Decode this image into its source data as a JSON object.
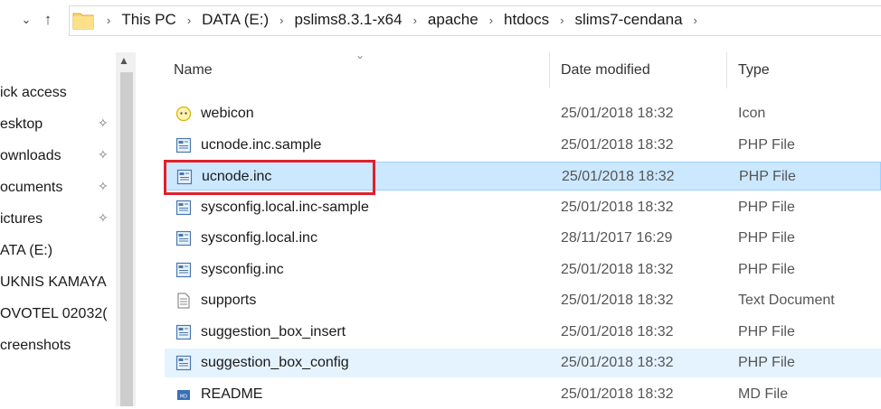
{
  "breadcrumb": [
    "This PC",
    "DATA (E:)",
    "pslims8.3.1-x64",
    "apache",
    "htdocs",
    "slims7-cendana"
  ],
  "nav": [
    {
      "label": "ick access",
      "pinned": false
    },
    {
      "label": "esktop",
      "pinned": true
    },
    {
      "label": "ownloads",
      "pinned": true
    },
    {
      "label": "ocuments",
      "pinned": true
    },
    {
      "label": "ictures",
      "pinned": true
    },
    {
      "label": "ATA (E:)",
      "pinned": false
    },
    {
      "label": "UKNIS KAMAYA",
      "pinned": false
    },
    {
      "label": "OVOTEL 02032(",
      "pinned": false
    },
    {
      "label": "creenshots",
      "pinned": false
    }
  ],
  "columns": {
    "name": "Name",
    "date": "Date modified",
    "type": "Type"
  },
  "files": [
    {
      "name": "webicon",
      "date": "25/01/2018 18:32",
      "type": "Icon",
      "icon": "favicon-icon"
    },
    {
      "name": "ucnode.inc.sample",
      "date": "25/01/2018 18:32",
      "type": "PHP File",
      "icon": "php-file-icon"
    },
    {
      "name": "ucnode.inc",
      "date": "25/01/2018 18:32",
      "type": "PHP File",
      "icon": "php-file-icon",
      "selected": true
    },
    {
      "name": "sysconfig.local.inc-sample",
      "date": "25/01/2018 18:32",
      "type": "PHP File",
      "icon": "php-file-icon"
    },
    {
      "name": "sysconfig.local.inc",
      "date": "28/11/2017 16:29",
      "type": "PHP File",
      "icon": "php-file-icon"
    },
    {
      "name": "sysconfig.inc",
      "date": "25/01/2018 18:32",
      "type": "PHP File",
      "icon": "php-file-icon"
    },
    {
      "name": "supports",
      "date": "25/01/2018 18:32",
      "type": "Text Document",
      "icon": "text-file-icon"
    },
    {
      "name": "suggestion_box_insert",
      "date": "25/01/2018 18:32",
      "type": "PHP File",
      "icon": "php-file-icon"
    },
    {
      "name": "suggestion_box_config",
      "date": "25/01/2018 18:32",
      "type": "PHP File",
      "icon": "php-file-icon",
      "hover": true
    },
    {
      "name": "README",
      "date": "25/01/2018 18:32",
      "type": "MD File",
      "icon": "md-file-icon"
    }
  ],
  "colors": {
    "selected_bg": "#cce8ff",
    "hover_bg": "#e5f3ff",
    "annotation_box": "#e0202a"
  }
}
